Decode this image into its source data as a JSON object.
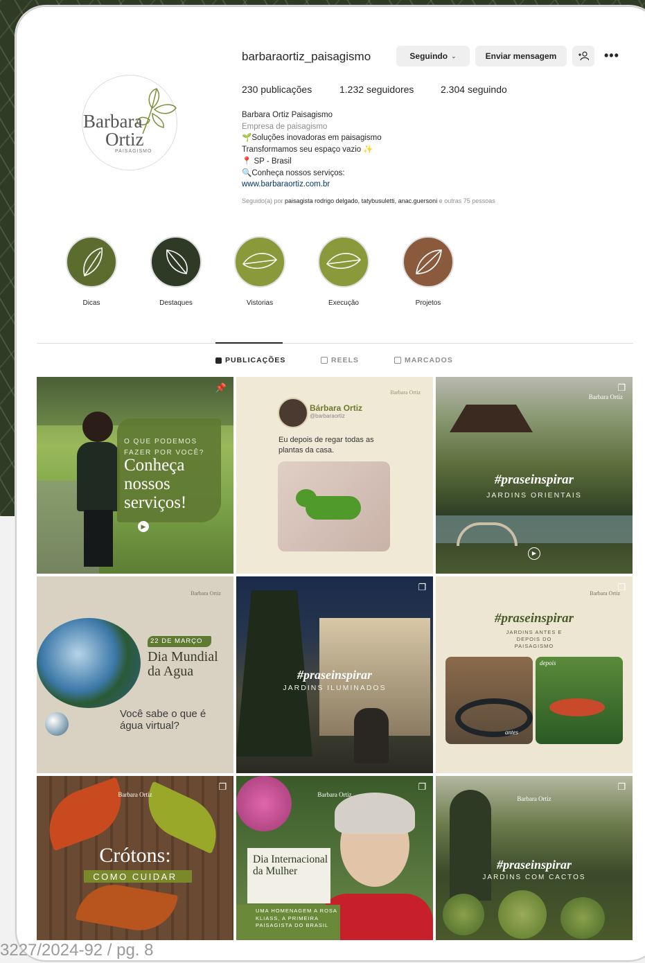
{
  "profile": {
    "username": "barbaraortiz_paisagismo",
    "logo_line1": "Barbara",
    "logo_line2": "Ortiz",
    "logo_sub": "PAISAGISMO"
  },
  "actions": {
    "following_label": "Seguindo",
    "message_label": "Enviar mensagem",
    "add_label": "+⁰",
    "more_label": "•••"
  },
  "stats": {
    "posts_num": "230",
    "posts_label": "publicações",
    "followers_num": "1.232",
    "followers_label": "seguidores",
    "following_num": "2.304",
    "following_label": "seguindo"
  },
  "bio": {
    "name": "Barbara Ortiz Paisagismo",
    "category": "Empresa de paisagismo",
    "line1": "🌱Soluções inovadoras em paisagismo",
    "line2": "Transformamos seu espaço vazio ✨",
    "line3": "📍 SP - Brasil",
    "line4": "🔍Conheça nossos serviços:",
    "website": "www.barbaraortiz.com.br"
  },
  "followed_by": {
    "prefix": "Seguido(a) por ",
    "names": "paisagista rodrigo delgado, tatybusuletti, anac.guersoni",
    "suffix": " e outras 75 pessoas"
  },
  "highlights": [
    {
      "label": "Dicas",
      "color": "#5c6b2e"
    },
    {
      "label": "Destaques",
      "color": "#2f3a26"
    },
    {
      "label": "Vistorias",
      "color": "#8a9a3a"
    },
    {
      "label": "Execução",
      "color": "#8a9a3a"
    },
    {
      "label": "Projetos",
      "color": "#8b5a3c"
    }
  ],
  "tabs": {
    "publicacoes": "PUBLICAÇÕES",
    "reels": "REELS",
    "marcados": "MARCADOS"
  },
  "posts": {
    "p1": {
      "kicker": "O QUE PODEMOS FAZER POR VOCÊ?",
      "title": "Conheça nossos serviços!"
    },
    "p2": {
      "name": "Bárbara Ortiz",
      "handle": "@barbaraortiz",
      "text": "Eu depois de regar todas as plantas da casa."
    },
    "p3": {
      "tag": "#praseinspirar",
      "sub": "JARDINS ORIENTAIS"
    },
    "p4": {
      "date": "22 DE MARÇO",
      "title": "Dia Mundial da Agua",
      "question": "Você sabe o que é água virtual?"
    },
    "p5": {
      "tag": "#praseinspirar",
      "sub": "JARDINS ILUMINADOS"
    },
    "p6": {
      "tag": "#praseinspirar",
      "sub": "JARDINS ANTES E DEPOIS DO PAISAGISMO",
      "before": "antes",
      "after": "depois"
    },
    "p7": {
      "title": "Crótons:",
      "sub": "COMO CUIDAR"
    },
    "p8": {
      "title": "Dia Internacional da Mulher",
      "sub": "UMA HOMENAGEM A ROSA KLIASS, A PRIMEIRA PAISAGISTA DO BRASIL"
    },
    "p9": {
      "tag": "#praseinspirar",
      "sub": "JARDINS COM CACTOS"
    },
    "watermark": "Barbara Ortiz"
  },
  "footer": {
    "doc_ref": "3227/2024-92 / pg. 8"
  }
}
